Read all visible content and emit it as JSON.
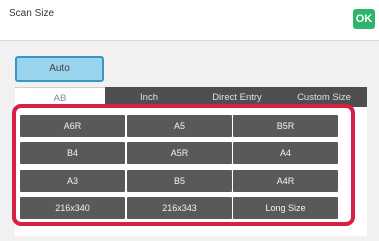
{
  "header": {
    "title": "Scan Size",
    "ok_label": "OK"
  },
  "auto_label": "Auto",
  "tabs": [
    {
      "label": "AB",
      "active": true
    },
    {
      "label": "Inch",
      "active": false
    },
    {
      "label": "Direct Entry",
      "active": false
    },
    {
      "label": "Custom Size",
      "active": false
    }
  ],
  "sizes": [
    [
      "A6R",
      "A5",
      "B5R"
    ],
    [
      "B4",
      "A5R",
      "A4"
    ],
    [
      "A3",
      "B5",
      "A4R"
    ],
    [
      "216x340",
      "216x343",
      "Long Size"
    ]
  ],
  "colors": {
    "ok_green": "#2fb56a",
    "auto_blue": "#9ad3ee",
    "highlight_red": "#d81f45",
    "button_gray": "#595959"
  }
}
